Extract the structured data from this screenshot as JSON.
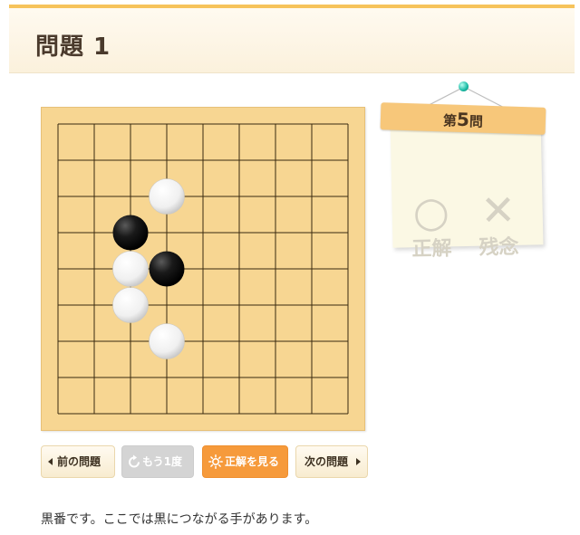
{
  "header": {
    "title": "問題 1"
  },
  "counter": {
    "prefix": "第",
    "number": "5",
    "suffix": "問",
    "correct": {
      "mark": "○",
      "label": "正解"
    },
    "wrong": {
      "mark": "✕",
      "label": "残念"
    }
  },
  "board": {
    "size": 9,
    "stones": [
      {
        "color": "white",
        "col": 4,
        "row": 3
      },
      {
        "color": "black",
        "col": 3,
        "row": 4
      },
      {
        "color": "white",
        "col": 3,
        "row": 5
      },
      {
        "color": "black",
        "col": 4,
        "row": 5
      },
      {
        "color": "white",
        "col": 3,
        "row": 6
      },
      {
        "color": "white",
        "col": 4,
        "row": 7
      }
    ]
  },
  "controls": {
    "prev_label": "前の問題",
    "retry_label": "もう1度",
    "answer_label": "正解を見る",
    "next_label": "次の問題"
  },
  "instruction": "黒番です。ここでは黒につながる手があります。",
  "colors": {
    "board": "#f7d692",
    "accent_orange": "#f69a3b",
    "header_border": "#f6c35b",
    "note_bg": "#fbf8e4",
    "banner": "#f7c77a"
  }
}
